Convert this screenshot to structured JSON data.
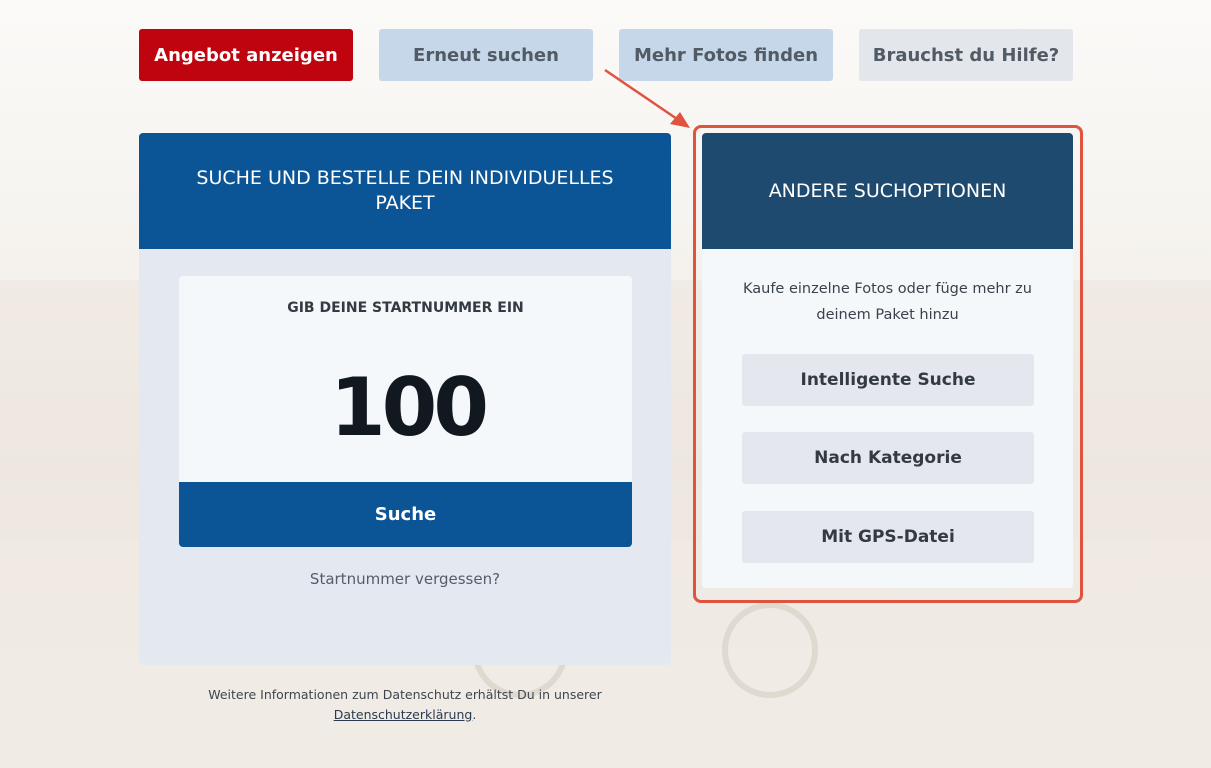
{
  "top_buttons": {
    "offer": "Angebot anzeigen",
    "search_again": "Erneut suchen",
    "more_photos": "Mehr Fotos finden",
    "help": "Brauchst du Hilfe?"
  },
  "left_card": {
    "title": "SUCHE UND BESTELLE DEIN INDIVIDUELLES PAKET",
    "input_label": "GIB DEINE STARTNUMMER EIN",
    "start_number": "100",
    "search_button": "Suche",
    "forgot_link": "Startnummer vergessen?"
  },
  "right_card": {
    "title": "ANDERE SUCHOPTIONEN",
    "description": "Kaufe einzelne Fotos oder füge mehr zu deinem Paket hinzu",
    "options": [
      "Intelligente Suche",
      "Nach Kategorie",
      "Mit GPS-Datei"
    ]
  },
  "privacy": {
    "text": "Weitere Informationen zum Datenschutz erhältst Du in unserer",
    "link": "Datenschutzerklärung",
    "suffix": "."
  },
  "colors": {
    "accent_red": "#c0040f",
    "primary_blue": "#0b5596",
    "dark_blue": "#1f4a6f",
    "highlight": "#e0533f"
  }
}
